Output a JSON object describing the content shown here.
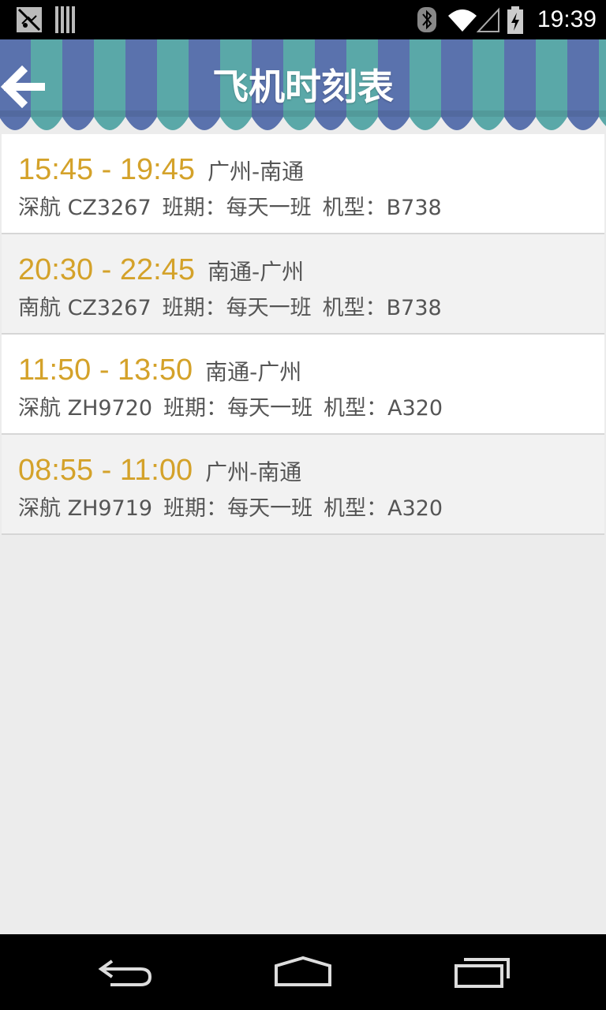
{
  "status_bar": {
    "time": "19:39",
    "icons": [
      "notification-icon",
      "barcode-icon",
      "bluetooth-icon",
      "wifi-icon",
      "signal-icon",
      "battery-icon"
    ]
  },
  "header": {
    "title": "飞机时刻表",
    "back_icon": "back-arrow-icon",
    "stripe_colors": [
      "#5a72ad",
      "#5aa8a8"
    ]
  },
  "flights": [
    {
      "time": "15:45 - 19:45",
      "route": "广州-南通",
      "flight": "深航 CZ3267",
      "schedule": "班期：每天一班",
      "aircraft": "机型：B738"
    },
    {
      "time": "20:30 - 22:45",
      "route": "南通-广州",
      "flight": "南航 CZ3267",
      "schedule": "班期：每天一班",
      "aircraft": "机型：B738"
    },
    {
      "time": "11:50 - 13:50",
      "route": "南通-广州",
      "flight": "深航 ZH9720",
      "schedule": "班期：每天一班",
      "aircraft": "机型：A320"
    },
    {
      "time": "08:55 - 11:00",
      "route": "广州-南通",
      "flight": "深航 ZH9719",
      "schedule": "班期：每天一班",
      "aircraft": "机型：A320"
    }
  ],
  "colors": {
    "time_accent": "#d4a22a",
    "text": "#555555",
    "background": "#ececec"
  },
  "nav_bar": {
    "icons": [
      "back-nav-icon",
      "home-nav-icon",
      "recents-nav-icon"
    ]
  }
}
